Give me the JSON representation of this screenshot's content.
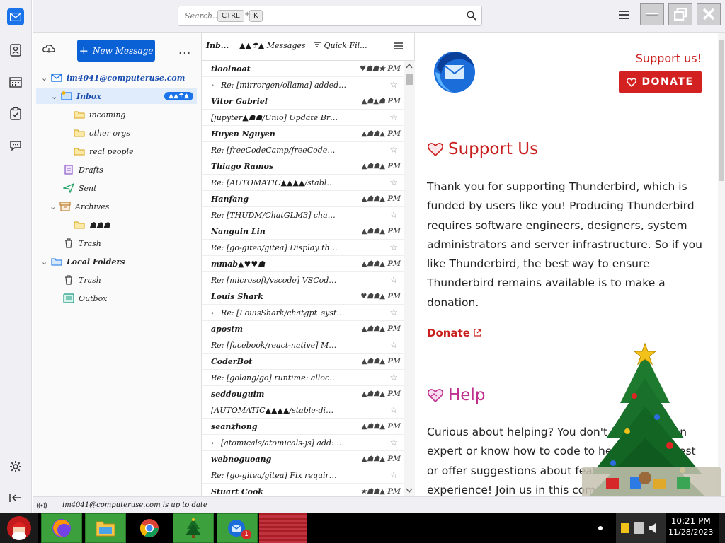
{
  "titlebar": {
    "search_placeholder": "Search...",
    "kbd_ctrl": "CTRL",
    "kbd_plus": "+",
    "kbd_k": "K"
  },
  "folders": {
    "new_message": "New Message",
    "more": "...",
    "items": [
      {
        "label": "im4041@computeruse.com",
        "type": "account"
      },
      {
        "label": "Inbox",
        "badge": "▲▲☂▲",
        "type": "inbox"
      },
      {
        "label": "incoming",
        "type": "folder"
      },
      {
        "label": "other orgs",
        "type": "folder"
      },
      {
        "label": "real people",
        "type": "folder"
      },
      {
        "label": "Drafts",
        "type": "drafts"
      },
      {
        "label": "Sent",
        "type": "sent"
      },
      {
        "label": "Archives",
        "type": "archives"
      },
      {
        "label": "☗☗☗",
        "type": "folder"
      },
      {
        "label": "Trash",
        "type": "trash"
      },
      {
        "label": "Local Folders",
        "type": "local"
      },
      {
        "label": "Trash",
        "type": "trash"
      },
      {
        "label": "Outbox",
        "type": "outbox"
      }
    ]
  },
  "list": {
    "header_label": "Inb...",
    "header_count": "▲▲☂▲ Messages",
    "header_filter": "Quick Fil...",
    "messages": [
      {
        "text": "tloolnoat",
        "meta": "♥☗☗★ PM",
        "kind": "from"
      },
      {
        "text": "Re: [mirrorgen/ollama] added quickstart...",
        "kind": "subject",
        "thread": true
      },
      {
        "text": "Vitor Gabriel",
        "meta": "▲☗▲☗ PM",
        "kind": "from"
      },
      {
        "text": "[jupyter▲☗☗/Unio] Update Brazilian Po...",
        "kind": "subject"
      },
      {
        "text": "Huyen Nguyen",
        "meta": "▲☗☗▲ PM",
        "kind": "from"
      },
      {
        "text": "Re: [freeCodeCamp/freeCodeCamp] feat(cu...",
        "kind": "subject"
      },
      {
        "text": "Thiago Ramos",
        "meta": "▲☗☗▲ PM",
        "kind": "from"
      },
      {
        "text": "Re: [AUTOMATIC▲▲▲▲/stable...",
        "kind": "subject"
      },
      {
        "text": "Hanfang",
        "meta": "▲☗☗▲ PM",
        "kind": "from"
      },
      {
        "text": "Re: [THUDM/ChatGLM3] chatglm...",
        "kind": "subject"
      },
      {
        "text": "Nanguin Lin",
        "meta": "▲☗☗▲ PM",
        "kind": "from"
      },
      {
        "text": "Re: [go-gitea/gitea] Display the number of...",
        "kind": "subject"
      },
      {
        "text": "mmab▲♥♥☗",
        "meta": "▲☗☗▲ PM",
        "kind": "from"
      },
      {
        "text": "Re: [microsoft/vscode] VSCode hangs afte...",
        "kind": "subject"
      },
      {
        "text": "Louis Shark",
        "meta": "♥☗☗▲ PM",
        "kind": "from"
      },
      {
        "text": "Re: [LouisShark/chatgpt_system_prompt]...",
        "kind": "subject",
        "thread": true
      },
      {
        "text": "apostm",
        "meta": "▲☗☗▲ PM",
        "kind": "from"
      },
      {
        "text": "Re: [facebook/react-native] Multiline Text...",
        "kind": "subject"
      },
      {
        "text": "CoderBot",
        "meta": "▲☗☗▲ PM",
        "kind": "from"
      },
      {
        "text": "Re: [golang/go] runtime: allocated pages bel...",
        "kind": "subject"
      },
      {
        "text": "seddouguim",
        "meta": "▲☗☗▲ PM",
        "kind": "from"
      },
      {
        "text": "[AUTOMATIC▲▲▲▲/stable-diffusion...",
        "kind": "subject"
      },
      {
        "text": "seanzhong",
        "meta": "▲☗☗▲ PM",
        "kind": "from"
      },
      {
        "text": "[atomicals/atomicals-js] add: pnpm support...",
        "kind": "subject",
        "thread": true
      },
      {
        "text": "webnoguoang",
        "meta": "▲☗☗▲ PM",
        "kind": "from"
      },
      {
        "text": "Re: [go-gitea/gitea] Fix required issue for l...",
        "kind": "subject"
      },
      {
        "text": "Stuart Cook",
        "meta": "★☗☗▲ PM",
        "kind": "from"
      }
    ]
  },
  "pane": {
    "support_us_link": "Support us!",
    "donate_button": "DONATE",
    "heading_support": "Support Us",
    "para_support": "Thank you for supporting Thunderbird, which is funded by users like you! Producing Thunderbird requires software engineers, designers, system administrators and server infrastructure. So if you like Thunderbird, the best way to ensure Thunderbird remains available is to make a donation.",
    "donate_link": "Donate",
    "heading_help": "Help",
    "para_help": "Curious about helping? You don't have to be an expert or know how to code to help. You can test or offer suggestions about features and your experience! Join us in this community."
  },
  "status": {
    "text": "im4041@computeruse.com is up to date"
  },
  "taskbar": {
    "time": "10:21 PM",
    "date": "11/28/2023",
    "notification_count": "1"
  },
  "colors": {
    "accent": "#0a61d6",
    "donate_red": "#d32020",
    "help_pink": "#d0359e"
  }
}
